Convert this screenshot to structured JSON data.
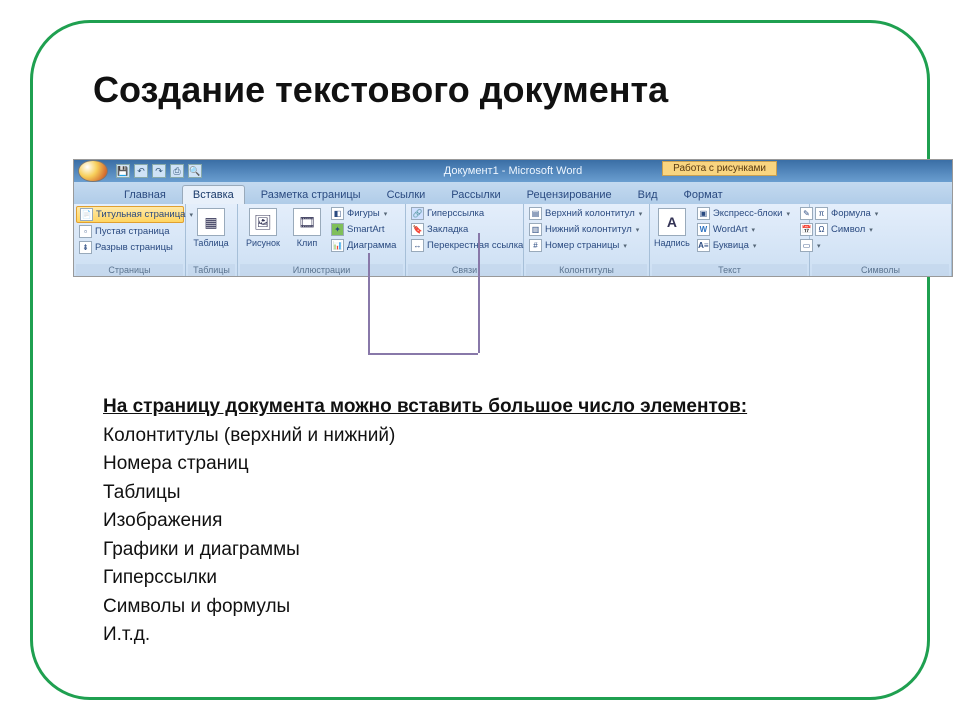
{
  "slide": {
    "title": "Создание текстового документа"
  },
  "window": {
    "title": "Документ1 - Microsoft Word",
    "context_tab": "Работа с рисунками"
  },
  "tabs": {
    "home": "Главная",
    "insert": "Вставка",
    "layout": "Разметка страницы",
    "refs": "Ссылки",
    "mail": "Рассылки",
    "review": "Рецензирование",
    "view": "Вид",
    "format": "Формат"
  },
  "groups": {
    "pages": {
      "label": "Страницы",
      "cover": "Титульная страница",
      "blank": "Пустая страница",
      "break": "Разрыв страницы"
    },
    "tables": {
      "label": "Таблицы",
      "table": "Таблица"
    },
    "illus": {
      "label": "Иллюстрации",
      "picture": "Рисунок",
      "clip": "Клип",
      "shapes": "Фигуры",
      "smart": "SmartArt",
      "chart": "Диаграмма"
    },
    "links": {
      "label": "Связи",
      "hyper": "Гиперссылка",
      "bookmark": "Закладка",
      "crossref": "Перекрестная ссылка"
    },
    "hf": {
      "label": "Колонтитулы",
      "header": "Верхний колонтитул",
      "footer": "Нижний колонтитул",
      "pagenum": "Номер страницы"
    },
    "text": {
      "label": "Текст",
      "textbox": "Надпись",
      "quick": "Экспресс-блоки",
      "wordart": "WordArt",
      "dropcap": "Буквица"
    },
    "sym": {
      "label": "Символы",
      "eq": "Формула",
      "sym": "Символ"
    }
  },
  "body": {
    "intro": "На страницу документа можно вставить большое число элементов:",
    "items": [
      "Колонтитулы (верхний и нижний)",
      "Номера страниц",
      "Таблицы",
      "Изображения",
      "Графики и диаграммы",
      "Гиперссылки",
      "Символы и формулы",
      "И.т.д."
    ]
  }
}
